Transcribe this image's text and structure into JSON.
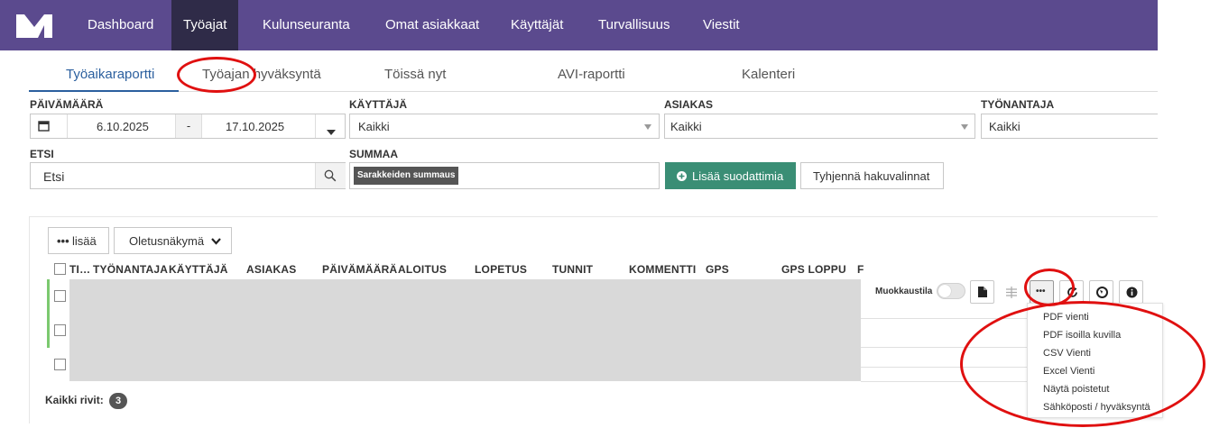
{
  "nav": {
    "items": [
      {
        "label": "Dashboard"
      },
      {
        "label": "Työajat"
      },
      {
        "label": "Kulunseuranta"
      },
      {
        "label": "Omat asiakkaat"
      },
      {
        "label": "Käyttäjät"
      },
      {
        "label": "Turvallisuus"
      },
      {
        "label": "Viestit"
      }
    ],
    "active": "Työajat"
  },
  "subtabs": [
    {
      "label": "Työaikaraportti"
    },
    {
      "label": "Työajan hyväksyntä"
    },
    {
      "label": "Töissä nyt"
    },
    {
      "label": "AVI-raportti"
    },
    {
      "label": "Kalenteri"
    }
  ],
  "filters": {
    "date_label": "PÄIVÄMÄÄRÄ",
    "date_from": "6.10.2025",
    "date_sep": "-",
    "date_to": "17.10.2025",
    "user_label": "KÄYTTÄJÄ",
    "user_value": "Kaikki",
    "client_label": "ASIAKAS",
    "client_value": "Kaikki",
    "employer_label": "TYÖNANTAJA",
    "employer_value": "Kaikki",
    "search_label": "ETSI",
    "search_placeholder": "Etsi",
    "sum_label": "SUMMAA",
    "sum_chip": "Sarakkeiden summaus",
    "add_filters_label": "Lisää suodattimia",
    "clear_label": "Tyhjennä hakuvalinnat"
  },
  "grid": {
    "more_label": "lisää",
    "view_label": "Oletusnäkymä",
    "columns": [
      "TI…",
      "TYÖNANTAJA",
      "KÄYTTÄJÄ",
      "ASIAKAS",
      "PÄIVÄMÄÄRÄ",
      "ALOITUS",
      "LOPETUS",
      "TUNNIT",
      "KOMMENTTI",
      "GPS",
      "GPS LOPPU",
      "F"
    ],
    "edit_mode_label": "Muokkaustila",
    "edit_mode_on": false,
    "footer_label": "Kaikki rivit:",
    "row_count": "3"
  },
  "export_menu": {
    "items": [
      {
        "label": "PDF vienti"
      },
      {
        "label": "PDF isoilla kuvilla"
      },
      {
        "label": "CSV Vienti"
      },
      {
        "label": "Excel Vienti"
      },
      {
        "label": "Näytä poistetut"
      },
      {
        "label": "Sähköposti / hyväksyntä"
      }
    ]
  },
  "colors": {
    "nav_bg": "#5b4a8e",
    "nav_active": "#2f2b48",
    "primary_button": "#3a8e75",
    "highlight_ring": "#e01010"
  }
}
